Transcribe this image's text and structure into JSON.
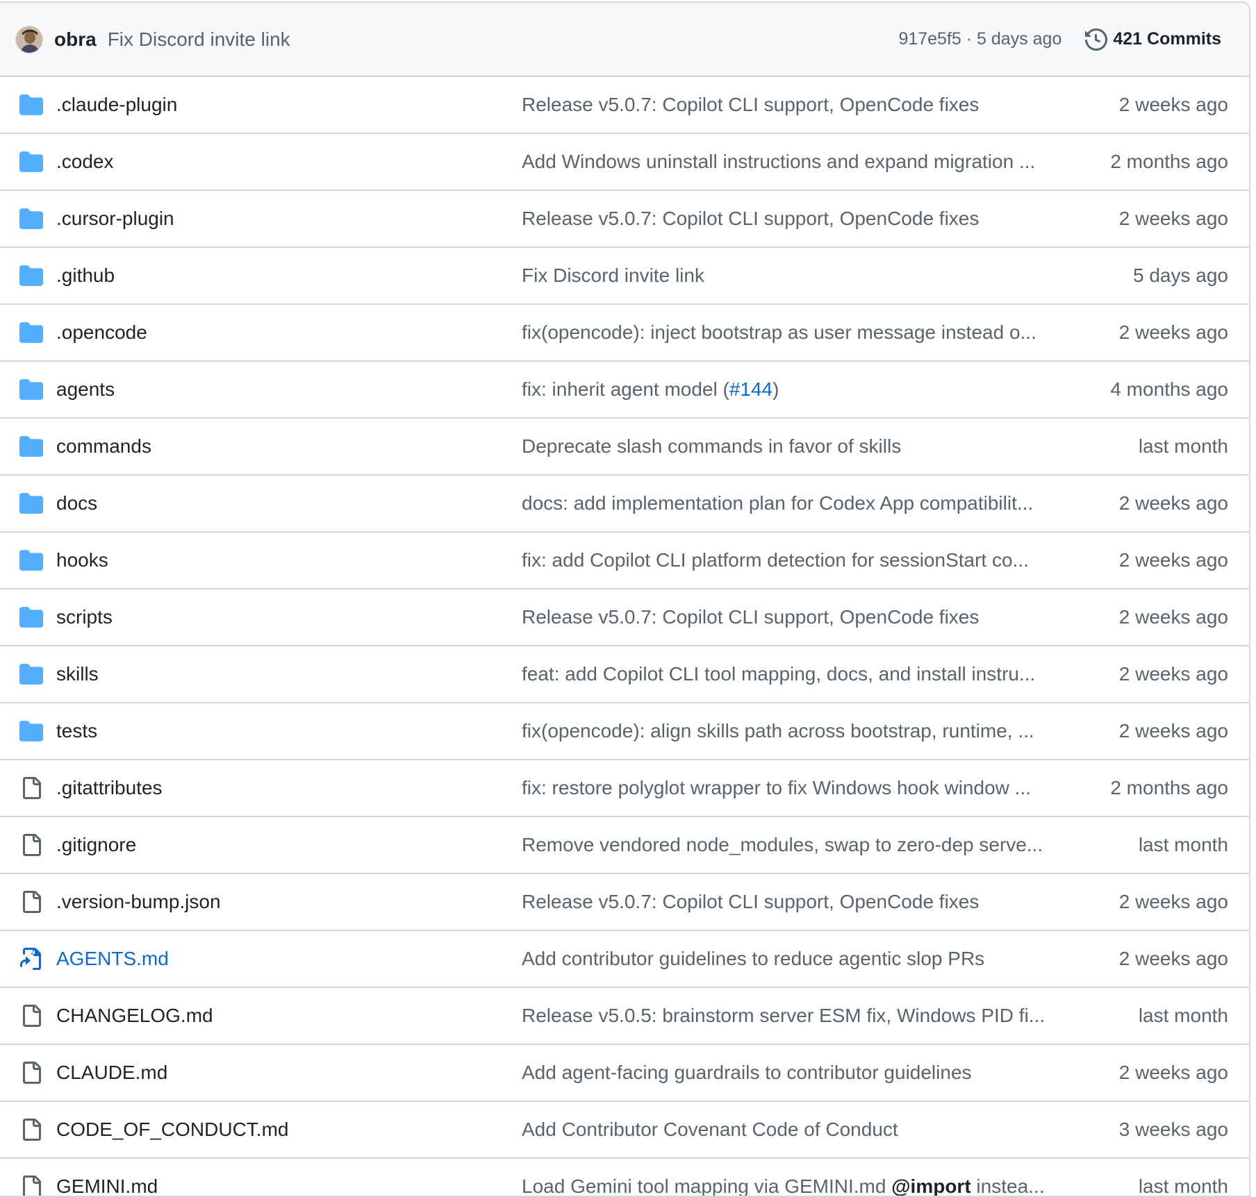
{
  "latest_commit": {
    "author": "obra",
    "message": "Fix Discord invite link",
    "sha": "917e5f5",
    "separator": "·",
    "age": "5 days ago",
    "commits_label": "421 Commits"
  },
  "files": [
    {
      "name": ".claude-plugin",
      "type": "folder",
      "message": "Release v5.0.7: Copilot CLI support, OpenCode fixes",
      "age": "2 weeks ago"
    },
    {
      "name": ".codex",
      "type": "folder",
      "message": "Add Windows uninstall instructions and expand migration ...",
      "age": "2 months ago"
    },
    {
      "name": ".cursor-plugin",
      "type": "folder",
      "message": "Release v5.0.7: Copilot CLI support, OpenCode fixes",
      "age": "2 weeks ago"
    },
    {
      "name": ".github",
      "type": "folder",
      "message": "Fix Discord invite link",
      "age": "5 days ago"
    },
    {
      "name": ".opencode",
      "type": "folder",
      "message": "fix(opencode): inject bootstrap as user message instead o...",
      "age": "2 weeks ago"
    },
    {
      "name": "agents",
      "type": "folder",
      "message_prefix": "fix: inherit agent model (",
      "message_link": "#144",
      "message_suffix": ")",
      "age": "4 months ago"
    },
    {
      "name": "commands",
      "type": "folder",
      "message": "Deprecate slash commands in favor of skills",
      "age": "last month"
    },
    {
      "name": "docs",
      "type": "folder",
      "message": "docs: add implementation plan for Codex App compatibilit...",
      "age": "2 weeks ago"
    },
    {
      "name": "hooks",
      "type": "folder",
      "message": "fix: add Copilot CLI platform detection for sessionStart co...",
      "age": "2 weeks ago"
    },
    {
      "name": "scripts",
      "type": "folder",
      "message": "Release v5.0.7: Copilot CLI support, OpenCode fixes",
      "age": "2 weeks ago"
    },
    {
      "name": "skills",
      "type": "folder",
      "message": "feat: add Copilot CLI tool mapping, docs, and install instru...",
      "age": "2 weeks ago"
    },
    {
      "name": "tests",
      "type": "folder",
      "message": "fix(opencode): align skills path across bootstrap, runtime, ...",
      "age": "2 weeks ago"
    },
    {
      "name": ".gitattributes",
      "type": "file",
      "message": "fix: restore polyglot wrapper to fix Windows hook window ...",
      "age": "2 months ago"
    },
    {
      "name": ".gitignore",
      "type": "file",
      "message": "Remove vendored node_modules, swap to zero-dep serve...",
      "age": "last month"
    },
    {
      "name": ".version-bump.json",
      "type": "file",
      "message": "Release v5.0.7: Copilot CLI support, OpenCode fixes",
      "age": "2 weeks ago"
    },
    {
      "name": "AGENTS.md",
      "type": "symlink",
      "message": "Add contributor guidelines to reduce agentic slop PRs",
      "age": "2 weeks ago"
    },
    {
      "name": "CHANGELOG.md",
      "type": "file",
      "message": "Release v5.0.5: brainstorm server ESM fix, Windows PID fi...",
      "age": "last month"
    },
    {
      "name": "CLAUDE.md",
      "type": "file",
      "message": "Add agent-facing guardrails to contributor guidelines",
      "age": "2 weeks ago"
    },
    {
      "name": "CODE_OF_CONDUCT.md",
      "type": "file",
      "message": "Add Contributor Covenant Code of Conduct",
      "age": "3 weeks ago"
    },
    {
      "name": "GEMINI.md",
      "type": "file",
      "message_prefix": "Load Gemini tool mapping via GEMINI.md ",
      "message_strong": "@import",
      "message_suffix": " instea...",
      "age": "last month"
    }
  ],
  "icons": {
    "folder": "folder-icon",
    "file": "file-icon",
    "symlink": "symlink-file-icon",
    "history": "history-icon"
  },
  "colors": {
    "folder": "#54aeff",
    "file": "#59636e",
    "link": "#0969da",
    "muted": "#59636e",
    "border": "#d1d9e0",
    "header_bg": "#f6f8fa"
  }
}
